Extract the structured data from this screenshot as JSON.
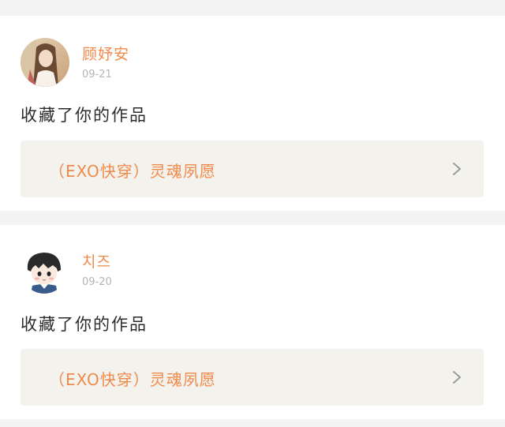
{
  "colors": {
    "accent": "#f08a4b",
    "page_background": "#f3f3f3",
    "card_background": "#ffffff",
    "link_background": "#f3f2ec",
    "date_text": "#b4b4b4",
    "body_text": "#2b2b2b"
  },
  "notifications": [
    {
      "username": "顾妤安",
      "date": "09-21",
      "action": "收藏了你的作品",
      "work_title": "（EXO快穿）灵魂夙愿",
      "avatar": "avatar-photo",
      "link_icon": "chevron-right-icon"
    },
    {
      "username": "치즈",
      "date": "09-20",
      "action": "收藏了你的作品",
      "work_title": "（EXO快穿）灵魂夙愿",
      "avatar": "avatar-cartoon",
      "link_icon": "chevron-right-icon"
    }
  ]
}
